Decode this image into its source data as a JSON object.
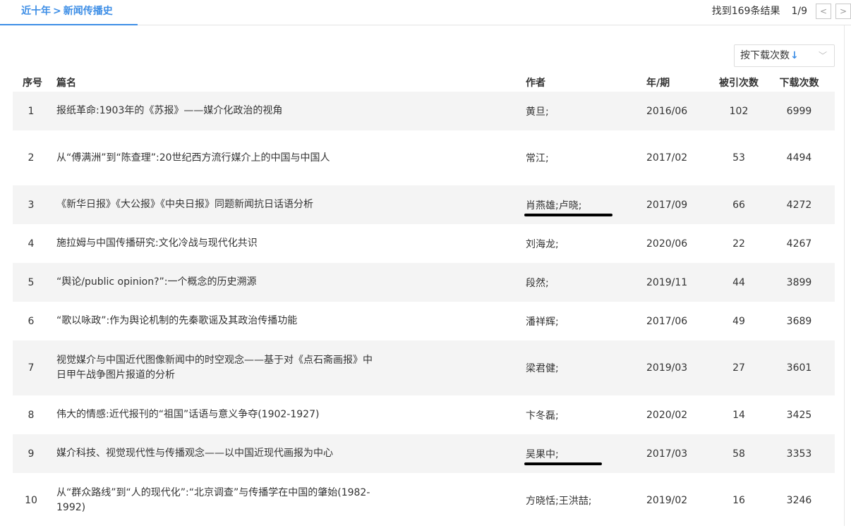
{
  "breadcrumb": {
    "root": "近十年",
    "separator": ">",
    "current": "新闻传播史"
  },
  "results": {
    "count_text": "找到169条结果",
    "page_text": "1/9"
  },
  "pager": {
    "prev": "<",
    "next": ">"
  },
  "sort": {
    "label": "按下载次数",
    "direction_icon": "↓"
  },
  "table": {
    "headers": {
      "index": "序号",
      "title": "篇名",
      "author": "作者",
      "date": "年/期",
      "cites": "被引次数",
      "downloads": "下载次数"
    },
    "rows": [
      {
        "index": "1",
        "title": "报纸革命:1903年的《苏报》——媒介化政治的视角",
        "author": "黄旦;",
        "date": "2016/06",
        "cites": "102",
        "downloads": "6999"
      },
      {
        "index": "2",
        "title": "从“傅满洲”到“陈查理”:20世纪西方流行媒介上的中国与中国人",
        "author": "常江;",
        "date": "2017/02",
        "cites": "53",
        "downloads": "4494"
      },
      {
        "index": "3",
        "title": "《新华日报》《大公报》《中央日报》同题新闻抗日话语分析",
        "author": "肖燕雄;卢晓;",
        "date": "2017/09",
        "cites": "66",
        "downloads": "4272"
      },
      {
        "index": "4",
        "title": "施拉姆与中国传播研究:文化冷战与现代化共识",
        "author": "刘海龙;",
        "date": "2020/06",
        "cites": "22",
        "downloads": "4267"
      },
      {
        "index": "5",
        "title": "“舆论/public opinion?”:一个概念的历史溯源",
        "author": "段然;",
        "date": "2019/11",
        "cites": "44",
        "downloads": "3899"
      },
      {
        "index": "6",
        "title": "“歌以咏政”:作为舆论机制的先秦歌谣及其政治传播功能",
        "author": "潘祥辉;",
        "date": "2017/06",
        "cites": "49",
        "downloads": "3689"
      },
      {
        "index": "7",
        "title": "视觉媒介与中国近代图像新闻中的时空观念——基于对《点石斋画报》中日甲午战争图片报道的分析",
        "author": "梁君健;",
        "date": "2019/03",
        "cites": "27",
        "downloads": "3601"
      },
      {
        "index": "8",
        "title": "伟大的情感:近代报刊的“祖国”话语与意义争夺(1902-1927)",
        "author": "卞冬磊;",
        "date": "2020/02",
        "cites": "14",
        "downloads": "3425"
      },
      {
        "index": "9",
        "title": "媒介科技、视觉现代性与传播观念——以中国近现代画报为中心",
        "author": "吴果中;",
        "date": "2017/03",
        "cites": "58",
        "downloads": "3353"
      },
      {
        "index": "10",
        "title": "从“群众路线”到“人的现代化”:“北京调查”与传播学在中国的肇始(1982-1992)",
        "author": "方晓恬;王洪喆;",
        "date": "2019/02",
        "cites": "16",
        "downloads": "3246"
      }
    ]
  },
  "colors": {
    "accent": "#3d8ee6",
    "row_stripe": "#f4f4f4",
    "annotation": "#000000"
  }
}
